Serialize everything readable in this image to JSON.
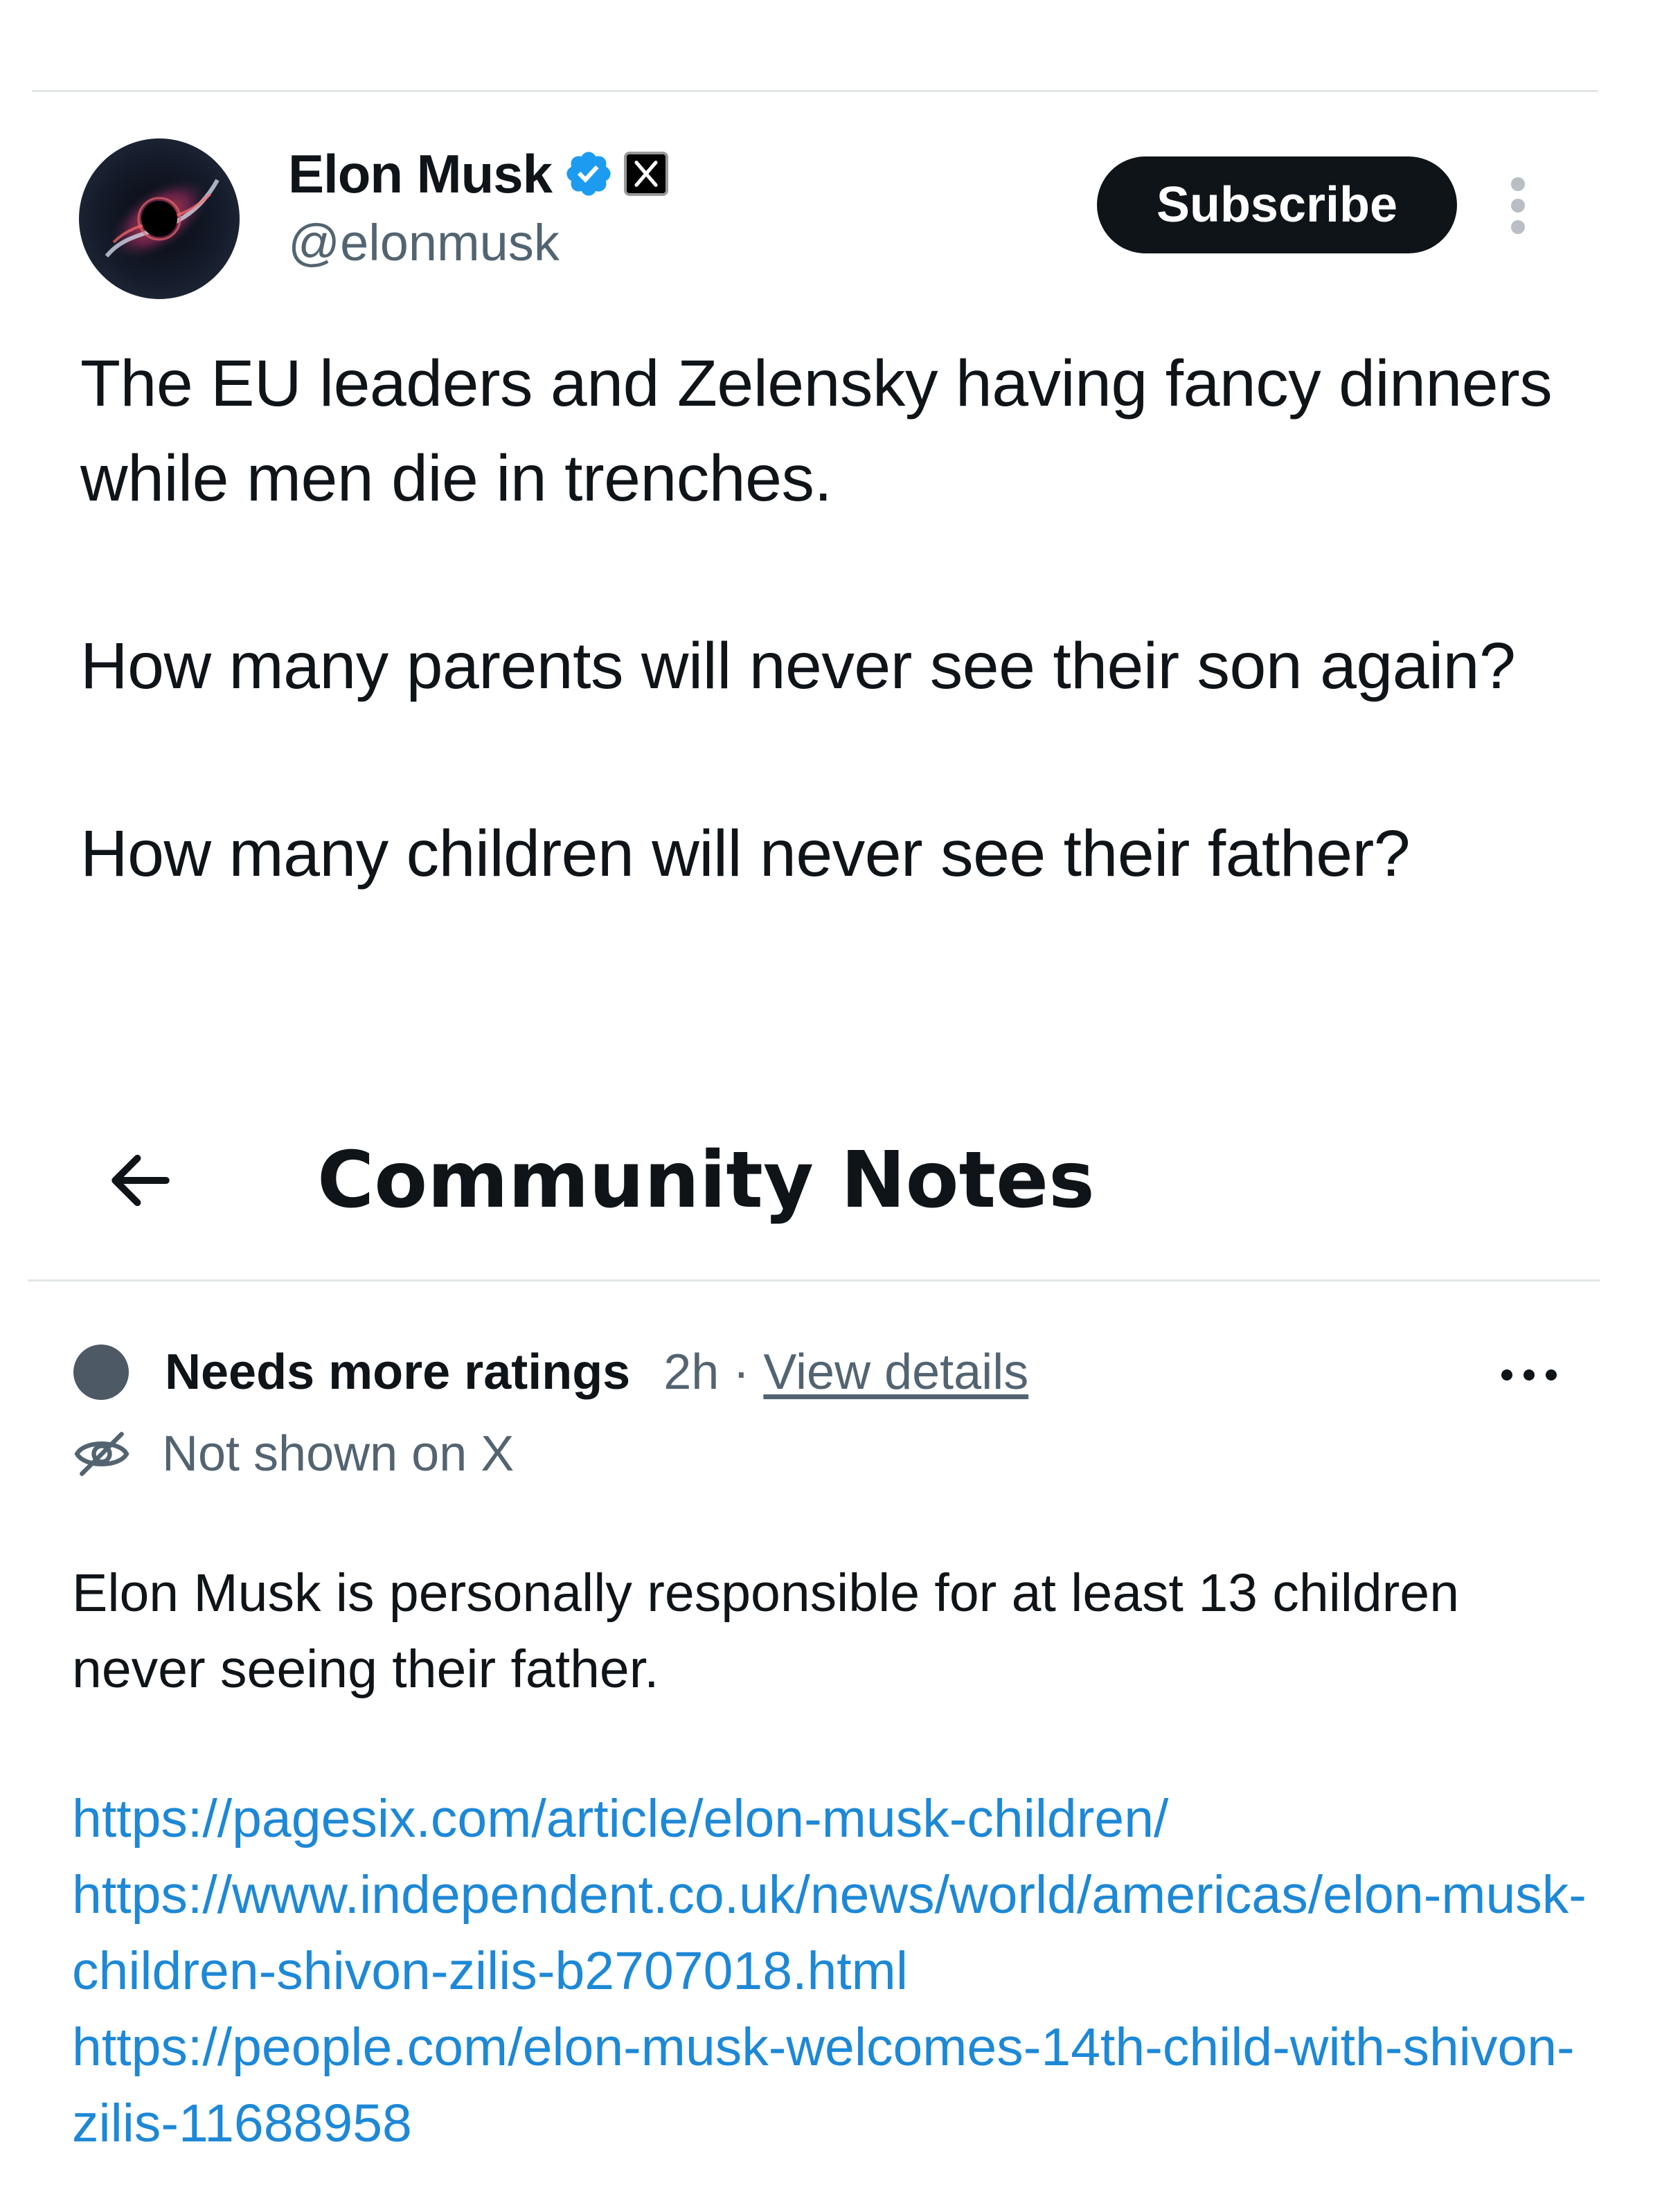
{
  "post": {
    "display_name": "Elon Musk",
    "handle": "@elonmusk",
    "subscribe_label": "Subscribe",
    "paragraphs": [
      "The EU leaders and Zelensky having fancy dinners while men die in trenches.",
      "How many parents will never see their son again?",
      "How many children will never see their father?"
    ],
    "verified_badge_color": "#1d9bf0"
  },
  "community_notes": {
    "title": "Community Notes",
    "status_label": "Needs more ratings",
    "time": "2h",
    "separator": "·",
    "view_details_label": "View details",
    "visibility_label": "Not shown on X",
    "note_text": "Elon Musk is personally responsible for at least 13 children never seeing their father.",
    "links": [
      "https://pagesix.com/article/elon-musk-children/",
      "https://www.independent.co.uk/news/world/americas/elon-musk-children-shivon-zilis-b2707018.html",
      "https://people.com/elon-musk-welcomes-14th-child-with-shivon-zilis-11688958"
    ],
    "link_color": "#1d88d6"
  }
}
